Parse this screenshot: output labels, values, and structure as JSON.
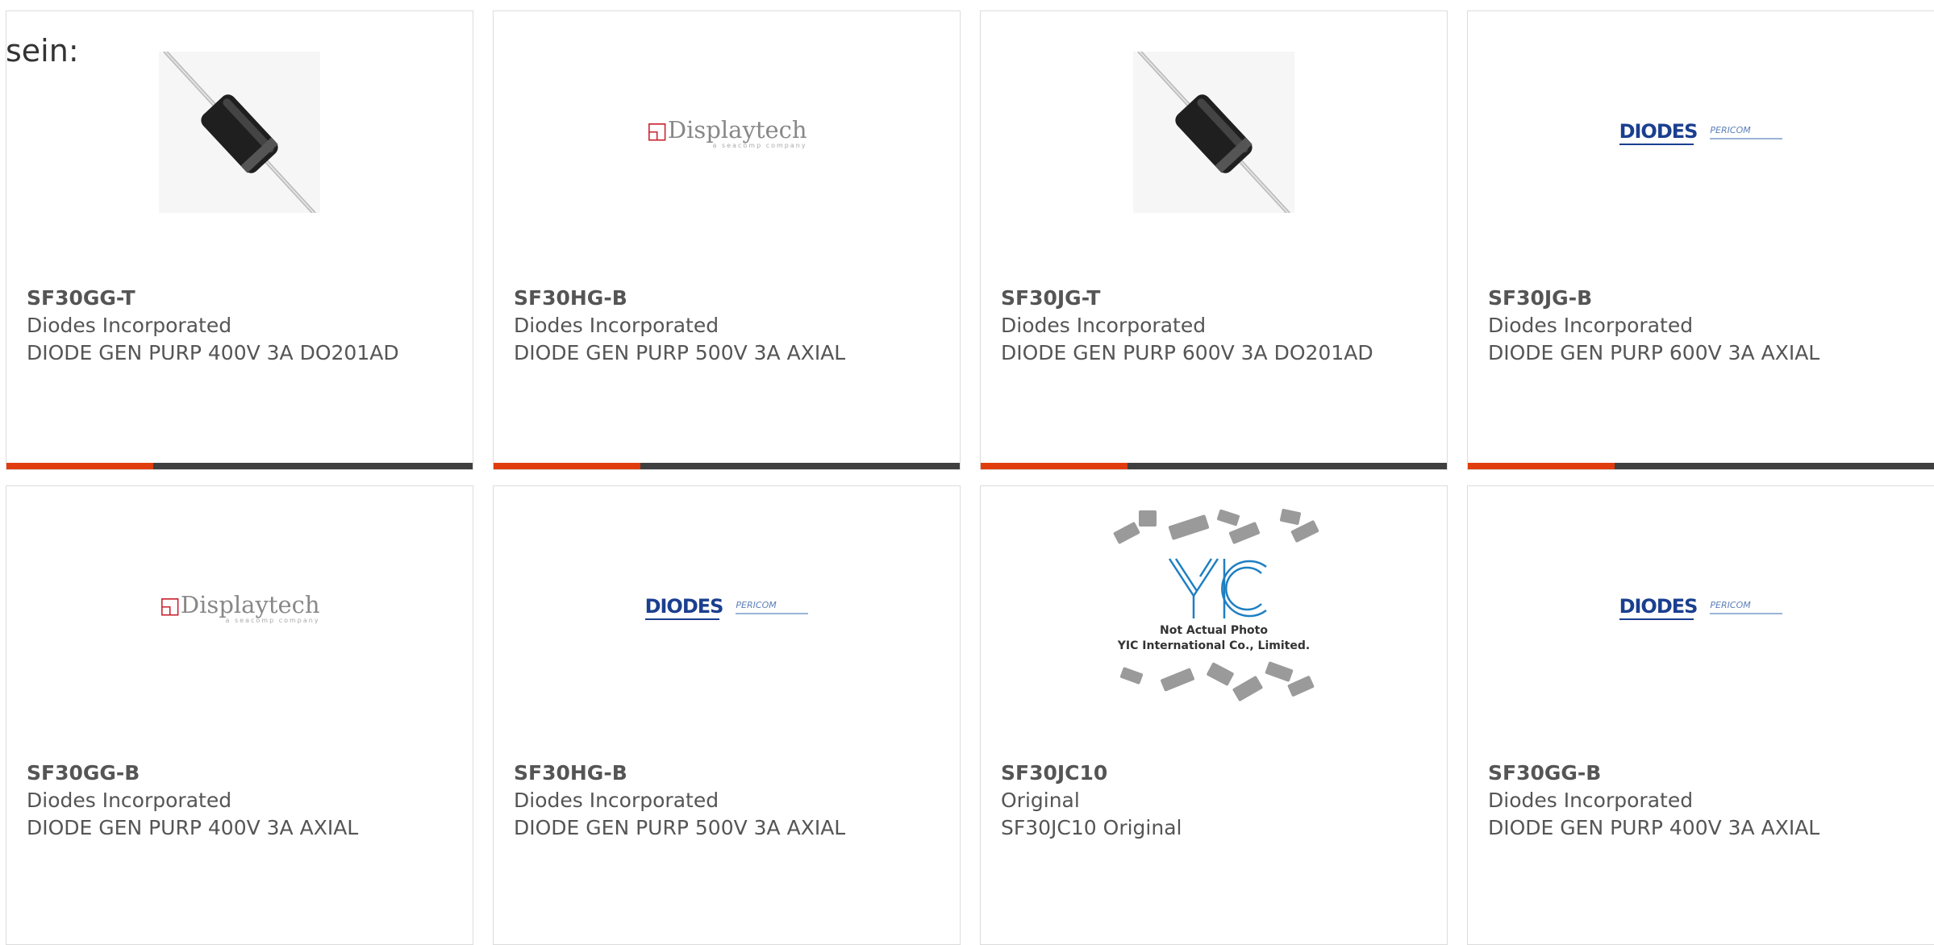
{
  "intro_text": "sein:",
  "colors": {
    "accent": "#e03c0d",
    "bar": "#3f3f3f",
    "text": "#555555",
    "border": "#dcdcdc"
  },
  "products": [
    {
      "part": "SF30GG-T",
      "maker": "Diodes Incorporated",
      "desc": "DIODE GEN PURP 400V 3A DO201AD",
      "image": "diode-photo"
    },
    {
      "part": "SF30HG-B",
      "maker": "Diodes Incorporated",
      "desc": "DIODE GEN PURP 500V 3A AXIAL",
      "image": "displaytech-logo",
      "logo": {
        "name": "Displaytech",
        "tagline": "a seacomp company"
      }
    },
    {
      "part": "SF30JG-T",
      "maker": "Diodes Incorporated",
      "desc": "DIODE GEN PURP 600V 3A DO201AD",
      "image": "diode-photo"
    },
    {
      "part": "SF30JG-B",
      "maker": "Diodes Incorporated",
      "desc": "DIODE GEN PURP 600V 3A AXIAL",
      "image": "diodes-pericom-logo",
      "logo": {
        "name": "DIODES",
        "secondary": "PERICOM"
      }
    },
    {
      "part": "SF30GG-B",
      "maker": "Diodes Incorporated",
      "desc": "DIODE GEN PURP 400V 3A AXIAL",
      "image": "displaytech-logo",
      "logo": {
        "name": "Displaytech",
        "tagline": "a seacomp company"
      }
    },
    {
      "part": "SF30HG-B",
      "maker": "Diodes Incorporated",
      "desc": "DIODE GEN PURP 500V 3A AXIAL",
      "image": "diodes-pericom-logo",
      "logo": {
        "name": "DIODES",
        "secondary": "PERICOM"
      }
    },
    {
      "part": "SF30JC10",
      "maker": "Original",
      "desc": "SF30JC10 Original",
      "image": "yic-placeholder",
      "logo": {
        "name": "YIC",
        "line1": "Not Actual Photo",
        "line2": "YIC International Co., Limited."
      }
    },
    {
      "part": "SF30GG-B",
      "maker": "Diodes Incorporated",
      "desc": "DIODE GEN PURP 400V 3A AXIAL",
      "image": "diodes-pericom-logo",
      "logo": {
        "name": "DIODES",
        "secondary": "PERICOM"
      }
    }
  ]
}
